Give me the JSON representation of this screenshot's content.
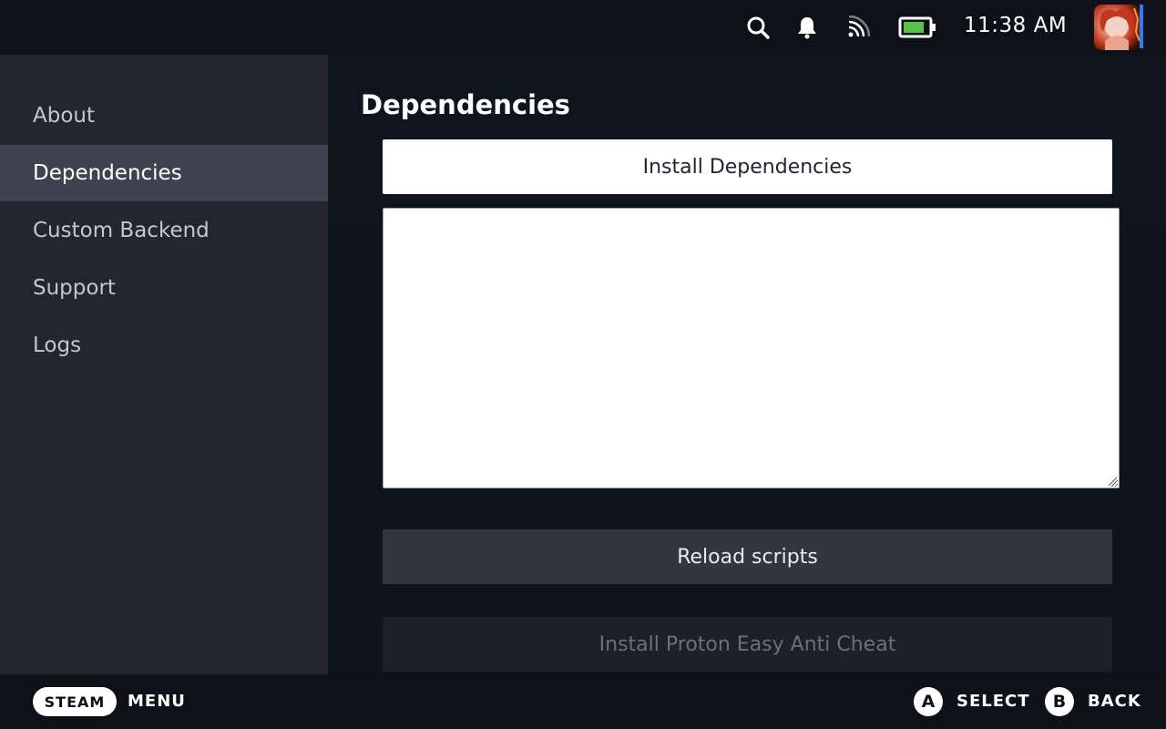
{
  "topbar": {
    "search_icon": "search-icon",
    "notifications_icon": "bell-icon",
    "network_icon": "wifi-icon",
    "battery_icon": "battery-icon",
    "battery_level": 0.85,
    "battery_color": "#5ac24a",
    "clock": "11:38 AM",
    "avatar_icon": "avatar"
  },
  "sidebar": {
    "items": [
      {
        "label": "About",
        "active": false
      },
      {
        "label": "Dependencies",
        "active": true
      },
      {
        "label": "Custom Backend",
        "active": false
      },
      {
        "label": "Support",
        "active": false
      },
      {
        "label": "Logs",
        "active": false
      }
    ]
  },
  "main": {
    "title": "Dependencies",
    "install_button": "Install Dependencies",
    "output_value": "",
    "reload_button": "Reload scripts",
    "eac_button": "Install Proton Easy Anti Cheat",
    "eac_disabled": true
  },
  "bottombar": {
    "steam_label": "STEAM",
    "menu_label": "MENU",
    "a_glyph": "A",
    "select_label": "SELECT",
    "b_glyph": "B",
    "back_label": "BACK"
  },
  "colors": {
    "sidebar_bg": "#23262e",
    "sidebar_active": "#3d4450",
    "main_bg": "#0e141b",
    "accent": "#2f7bff"
  }
}
